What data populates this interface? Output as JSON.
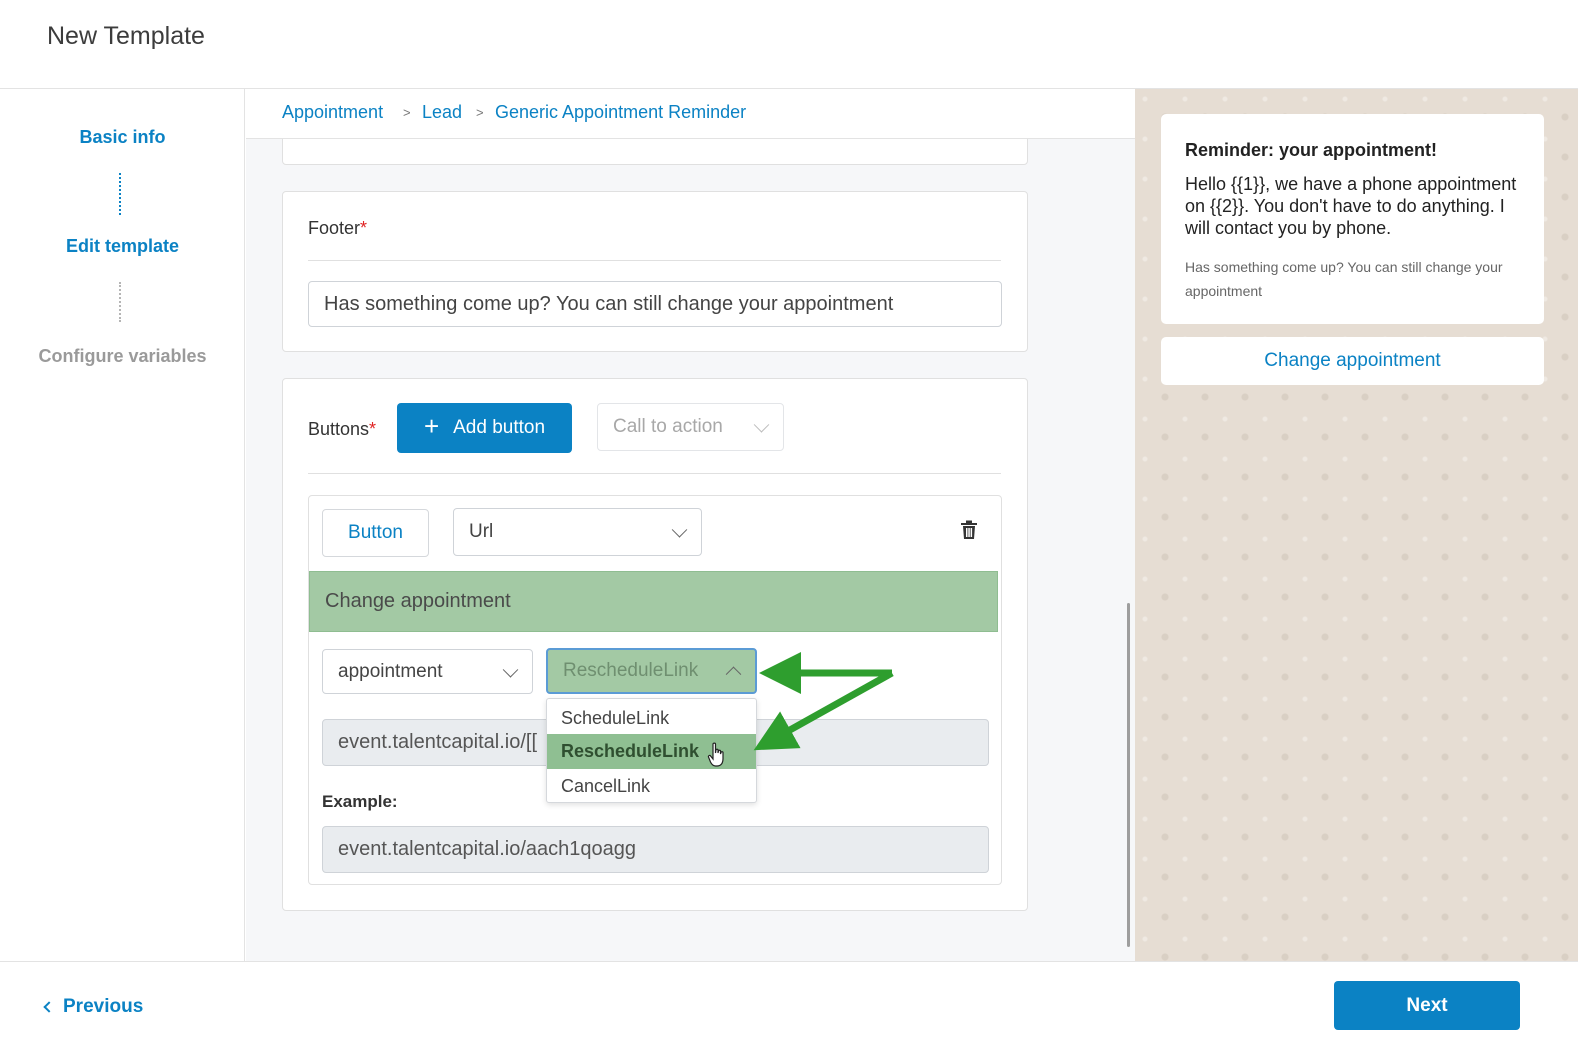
{
  "header": {
    "title": "New Template"
  },
  "steps": [
    {
      "label": "Basic info",
      "state": "active"
    },
    {
      "label": "Edit template",
      "state": "active"
    },
    {
      "label": "Configure variables",
      "state": "inactive"
    }
  ],
  "breadcrumb": [
    "Appointment",
    "Lead",
    "Generic Appointment Reminder"
  ],
  "breadcrumb_separator": ">",
  "footer_section": {
    "label": "Footer",
    "required_mark": "*",
    "value": "Has something come up? You can still change your appointment"
  },
  "buttons_section": {
    "label": "Buttons",
    "required_mark": "*",
    "add_button_icon": "+",
    "add_button_label": "Add button",
    "type_select": {
      "value": "Call to action",
      "disabled": true
    }
  },
  "button_item": {
    "type_label": "Button",
    "kind_select": "Url",
    "text_value": "Change appointment",
    "entity_select": "appointment",
    "field_select": "RescheduleLink",
    "url_value": "event.talentcapital.io/[[",
    "example_label": "Example:",
    "example_value": "event.talentcapital.io/aach1qoagg",
    "dropdown_options": [
      "ScheduleLink",
      "RescheduleLink",
      "CancelLink"
    ],
    "highlighted_option": "RescheduleLink"
  },
  "preview": {
    "header": "Reminder: your appointment!",
    "body": "Hello {{1}}, we have a phone appointment on {{2}}. You don't have to do anything. I will contact you by phone.",
    "footer": "Has something come up? You can still change your appointment",
    "button": "Change appointment"
  },
  "nav": {
    "previous_label": "Previous",
    "next_label": "Next"
  },
  "colors": {
    "accent": "#0b82c4",
    "highlight_green": "#a3c9a4",
    "annotation_arrow": "#2e9e2e",
    "required": "#e02424"
  }
}
